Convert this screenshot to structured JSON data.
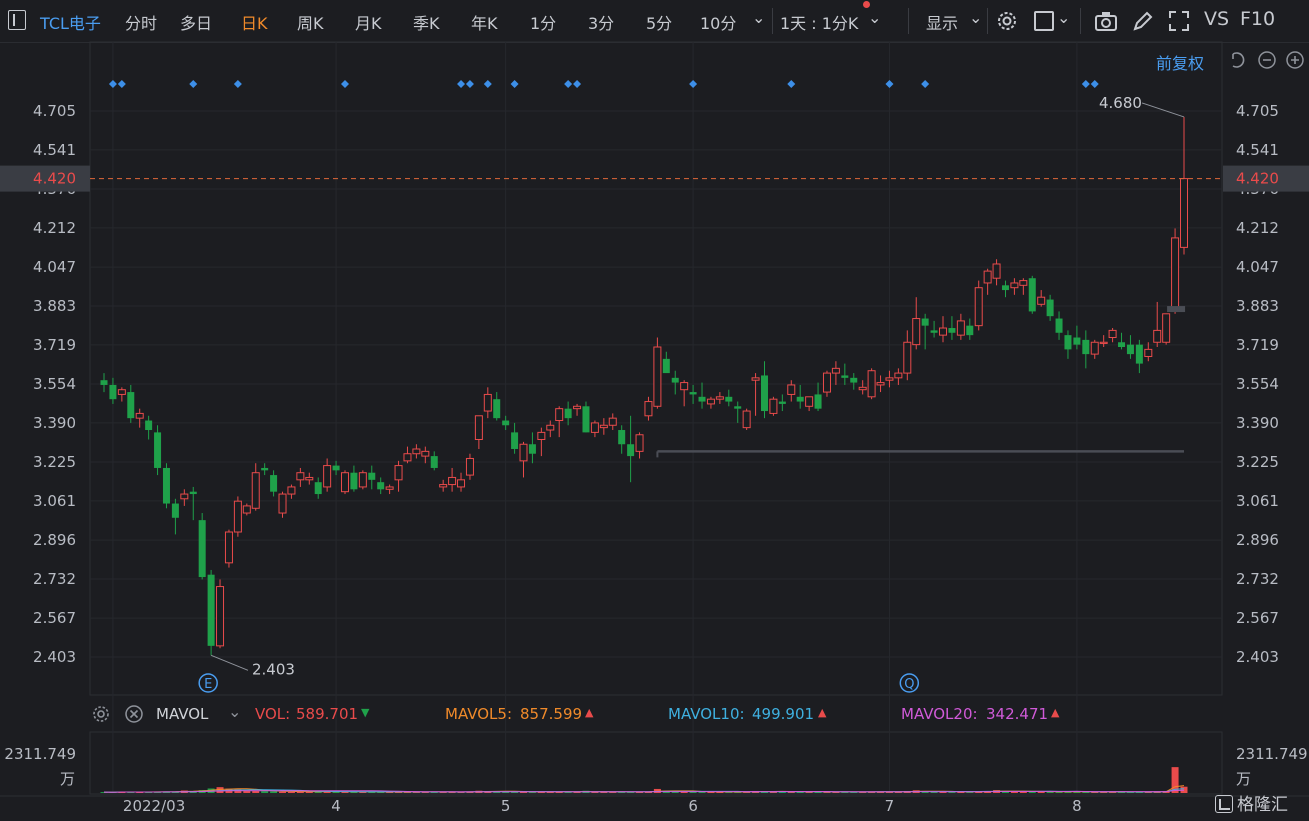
{
  "toolbar": {
    "sidebar_label": "|",
    "stock": "TCL电子",
    "tabs": [
      "分时",
      "多日",
      "日K",
      "周K",
      "月K",
      "季K",
      "年K",
      "1分",
      "3分",
      "5分",
      "10分"
    ],
    "active_tab": "日K",
    "interval": "1天 : 1分K",
    "display": "显示",
    "vs": "VS",
    "f10": "F10"
  },
  "adjust_label": "前复权",
  "icons": [
    "sidebar-icon",
    "chevron-down-icon",
    "gear-icon",
    "square-icon",
    "camera-icon",
    "pencil-icon",
    "fullscreen-icon",
    "undo-icon",
    "minus-circle-icon",
    "plus-circle-icon",
    "settings-icon",
    "close-circle-icon"
  ],
  "indicator": {
    "name": "MAVOL",
    "vol_label": "VOL:",
    "vol_value": "589.701",
    "mavol5_label": "MAVOL5:",
    "mavol5_value": "857.599",
    "mavol10_label": "MAVOL10:",
    "mavol10_value": "499.901",
    "mavol20_label": "MAVOL20:",
    "mavol20_value": "342.471"
  },
  "markers": {
    "e_label": "E",
    "q_label": "Q"
  },
  "logo": "格隆汇",
  "colors": {
    "up": "#e94b4b",
    "down": "#1fa14a",
    "last_price": "#e94b4b",
    "ma5": "#f08a2a",
    "ma10": "#3fb0e0",
    "ma20": "#d05ad8",
    "dots": "#3d8fe8"
  },
  "chart_data": {
    "type": "candlestick",
    "y_ticks": [
      "4.705",
      "4.541",
      "4.376",
      "4.212",
      "4.047",
      "3.883",
      "3.719",
      "3.554",
      "3.390",
      "3.225",
      "3.061",
      "2.896",
      "2.732",
      "2.567",
      "2.403"
    ],
    "ylim": [
      2.403,
      4.705
    ],
    "last_price": "4.420",
    "max_label": "4.680",
    "min_label": "2.403",
    "x_labels": [
      "2022/03",
      "4",
      "5",
      "6",
      "7",
      "8"
    ],
    "x_label_index": [
      1,
      26,
      45,
      66,
      88,
      109
    ],
    "support_level": 3.27,
    "support_range": [
      62,
      121
    ],
    "volume_max_label": "2311.749",
    "volume_unit": "万",
    "volume_max": 2311.749,
    "dot_index": [
      1,
      2,
      10,
      15,
      27,
      40,
      41,
      43,
      46,
      52,
      53,
      66,
      77,
      88,
      92,
      110,
      111
    ],
    "e_index": 11,
    "q_index": 90,
    "ohlc": [
      [
        3.57,
        3.6,
        3.52,
        3.55
      ],
      [
        3.55,
        3.58,
        3.47,
        3.49
      ],
      [
        3.51,
        3.54,
        3.48,
        3.53
      ],
      [
        3.52,
        3.55,
        3.39,
        3.41
      ],
      [
        3.41,
        3.45,
        3.37,
        3.43
      ],
      [
        3.4,
        3.42,
        3.32,
        3.36
      ],
      [
        3.35,
        3.38,
        3.17,
        3.2
      ],
      [
        3.2,
        3.22,
        3.03,
        3.05
      ],
      [
        3.05,
        3.07,
        2.92,
        2.99
      ],
      [
        3.07,
        3.11,
        3.04,
        3.09
      ],
      [
        3.1,
        3.12,
        2.98,
        3.09
      ],
      [
        2.98,
        3.01,
        2.73,
        2.74
      ],
      [
        2.75,
        2.77,
        2.41,
        2.45
      ],
      [
        2.45,
        2.73,
        2.44,
        2.7
      ],
      [
        2.8,
        2.94,
        2.78,
        2.93
      ],
      [
        2.93,
        3.08,
        2.91,
        3.06
      ],
      [
        3.01,
        3.05,
        3.0,
        3.04
      ],
      [
        3.03,
        3.22,
        3.02,
        3.18
      ],
      [
        3.2,
        3.22,
        3.17,
        3.19
      ],
      [
        3.17,
        3.19,
        3.08,
        3.1
      ],
      [
        3.01,
        3.1,
        2.99,
        3.09
      ],
      [
        3.09,
        3.13,
        3.07,
        3.12
      ],
      [
        3.15,
        3.2,
        3.12,
        3.18
      ],
      [
        3.15,
        3.18,
        3.13,
        3.16
      ],
      [
        3.14,
        3.16,
        3.07,
        3.09
      ],
      [
        3.12,
        3.24,
        3.1,
        3.21
      ],
      [
        3.21,
        3.23,
        3.17,
        3.19
      ],
      [
        3.1,
        3.19,
        3.09,
        3.18
      ],
      [
        3.18,
        3.21,
        3.1,
        3.11
      ],
      [
        3.12,
        3.19,
        3.11,
        3.18
      ],
      [
        3.18,
        3.21,
        3.11,
        3.15
      ],
      [
        3.14,
        3.16,
        3.09,
        3.11
      ],
      [
        3.11,
        3.13,
        3.09,
        3.12
      ],
      [
        3.15,
        3.23,
        3.1,
        3.21
      ],
      [
        3.23,
        3.29,
        3.22,
        3.26
      ],
      [
        3.26,
        3.3,
        3.24,
        3.28
      ],
      [
        3.25,
        3.29,
        3.22,
        3.27
      ],
      [
        3.25,
        3.27,
        3.19,
        3.2
      ],
      [
        3.12,
        3.15,
        3.1,
        3.13
      ],
      [
        3.13,
        3.2,
        3.1,
        3.16
      ],
      [
        3.12,
        3.18,
        3.1,
        3.15
      ],
      [
        3.17,
        3.26,
        3.15,
        3.24
      ],
      [
        3.32,
        3.42,
        3.28,
        3.42
      ],
      [
        3.44,
        3.54,
        3.41,
        3.51
      ],
      [
        3.49,
        3.52,
        3.4,
        3.41
      ],
      [
        3.4,
        3.42,
        3.36,
        3.38
      ],
      [
        3.35,
        3.39,
        3.26,
        3.28
      ],
      [
        3.23,
        3.31,
        3.16,
        3.3
      ],
      [
        3.3,
        3.35,
        3.22,
        3.26
      ],
      [
        3.32,
        3.37,
        3.25,
        3.35
      ],
      [
        3.36,
        3.4,
        3.33,
        3.38
      ],
      [
        3.4,
        3.46,
        3.33,
        3.45
      ],
      [
        3.45,
        3.48,
        3.38,
        3.41
      ],
      [
        3.45,
        3.47,
        3.42,
        3.46
      ],
      [
        3.46,
        3.48,
        3.35,
        3.35
      ],
      [
        3.35,
        3.4,
        3.33,
        3.39
      ],
      [
        3.37,
        3.41,
        3.34,
        3.38
      ],
      [
        3.38,
        3.43,
        3.36,
        3.41
      ],
      [
        3.36,
        3.38,
        3.26,
        3.3
      ],
      [
        3.3,
        3.42,
        3.14,
        3.25
      ],
      [
        3.27,
        3.35,
        3.24,
        3.34
      ],
      [
        3.42,
        3.5,
        3.4,
        3.48
      ],
      [
        3.46,
        3.75,
        3.45,
        3.71
      ],
      [
        3.66,
        3.69,
        3.62,
        3.6
      ],
      [
        3.58,
        3.61,
        3.51,
        3.56
      ],
      [
        3.53,
        3.57,
        3.46,
        3.56
      ],
      [
        3.52,
        3.55,
        3.47,
        3.51
      ],
      [
        3.5,
        3.56,
        3.45,
        3.48
      ],
      [
        3.47,
        3.5,
        3.45,
        3.49
      ],
      [
        3.49,
        3.52,
        3.47,
        3.5
      ],
      [
        3.5,
        3.53,
        3.46,
        3.48
      ],
      [
        3.46,
        3.48,
        3.39,
        3.45
      ],
      [
        3.37,
        3.45,
        3.36,
        3.44
      ],
      [
        3.57,
        3.6,
        3.42,
        3.58
      ],
      [
        3.59,
        3.65,
        3.41,
        3.44
      ],
      [
        3.43,
        3.5,
        3.42,
        3.49
      ],
      [
        3.48,
        3.51,
        3.44,
        3.47
      ],
      [
        3.51,
        3.57,
        3.48,
        3.55
      ],
      [
        3.5,
        3.55,
        3.45,
        3.48
      ],
      [
        3.46,
        3.5,
        3.44,
        3.5
      ],
      [
        3.51,
        3.56,
        3.44,
        3.45
      ],
      [
        3.52,
        3.61,
        3.5,
        3.6
      ],
      [
        3.6,
        3.65,
        3.55,
        3.62
      ],
      [
        3.59,
        3.64,
        3.55,
        3.58
      ],
      [
        3.58,
        3.6,
        3.53,
        3.56
      ],
      [
        3.53,
        3.57,
        3.51,
        3.54
      ],
      [
        3.5,
        3.62,
        3.49,
        3.61
      ],
      [
        3.55,
        3.59,
        3.52,
        3.56
      ],
      [
        3.57,
        3.61,
        3.54,
        3.58
      ],
      [
        3.58,
        3.62,
        3.55,
        3.6
      ],
      [
        3.6,
        3.78,
        3.57,
        3.73
      ],
      [
        3.72,
        3.92,
        3.7,
        3.83
      ],
      [
        3.83,
        3.85,
        3.7,
        3.8
      ],
      [
        3.78,
        3.82,
        3.75,
        3.77
      ],
      [
        3.76,
        3.84,
        3.73,
        3.79
      ],
      [
        3.79,
        3.84,
        3.74,
        3.77
      ],
      [
        3.76,
        3.85,
        3.74,
        3.82
      ],
      [
        3.8,
        3.83,
        3.74,
        3.76
      ],
      [
        3.8,
        3.99,
        3.78,
        3.96
      ],
      [
        3.98,
        4.04,
        3.93,
        4.03
      ],
      [
        4.0,
        4.08,
        3.97,
        4.06
      ],
      [
        3.97,
        3.99,
        3.92,
        3.95
      ],
      [
        3.96,
        4.0,
        3.93,
        3.98
      ],
      [
        3.97,
        4.0,
        3.93,
        3.99
      ],
      [
        4.0,
        4.01,
        3.85,
        3.86
      ],
      [
        3.89,
        3.95,
        3.88,
        3.92
      ],
      [
        3.91,
        3.93,
        3.82,
        3.84
      ],
      [
        3.83,
        3.86,
        3.74,
        3.77
      ],
      [
        3.76,
        3.78,
        3.66,
        3.7
      ],
      [
        3.75,
        3.8,
        3.7,
        3.72
      ],
      [
        3.74,
        3.78,
        3.62,
        3.68
      ],
      [
        3.68,
        3.74,
        3.66,
        3.73
      ],
      [
        3.73,
        3.76,
        3.71,
        3.73
      ],
      [
        3.75,
        3.79,
        3.73,
        3.78
      ],
      [
        3.73,
        3.77,
        3.7,
        3.71
      ],
      [
        3.72,
        3.76,
        3.66,
        3.68
      ],
      [
        3.72,
        3.74,
        3.6,
        3.64
      ],
      [
        3.67,
        3.73,
        3.65,
        3.7
      ],
      [
        3.73,
        3.9,
        3.71,
        3.78
      ],
      [
        3.73,
        3.85,
        3.72,
        3.85
      ],
      [
        3.87,
        4.21,
        3.85,
        4.17
      ],
      [
        4.13,
        4.68,
        4.1,
        4.42
      ]
    ],
    "volume": [
      40,
      35,
      60,
      45,
      50,
      40,
      45,
      70,
      70,
      110,
      90,
      130,
      200,
      260,
      190,
      170,
      110,
      90,
      80,
      70,
      55,
      50,
      60,
      70,
      60,
      75,
      60,
      55,
      50,
      45,
      50,
      45,
      40,
      45,
      50,
      60,
      45,
      55,
      40,
      45,
      40,
      65,
      100,
      80,
      75,
      60,
      55,
      55,
      45,
      50,
      55,
      50,
      60,
      45,
      100,
      60,
      45,
      40,
      45,
      55,
      50,
      60,
      180,
      90,
      80,
      60,
      55,
      50,
      45,
      45,
      40,
      45,
      65,
      90,
      80,
      55,
      60,
      50,
      45,
      55,
      50,
      60,
      45,
      40,
      45,
      50,
      70,
      60,
      45,
      50,
      90,
      120,
      80,
      50,
      60,
      50,
      45,
      55,
      60,
      80,
      130,
      90,
      70,
      60,
      50,
      80,
      60,
      50,
      45,
      60,
      50,
      50,
      45,
      40,
      50,
      40,
      45,
      50,
      70,
      90,
      1150,
      280
    ]
  }
}
